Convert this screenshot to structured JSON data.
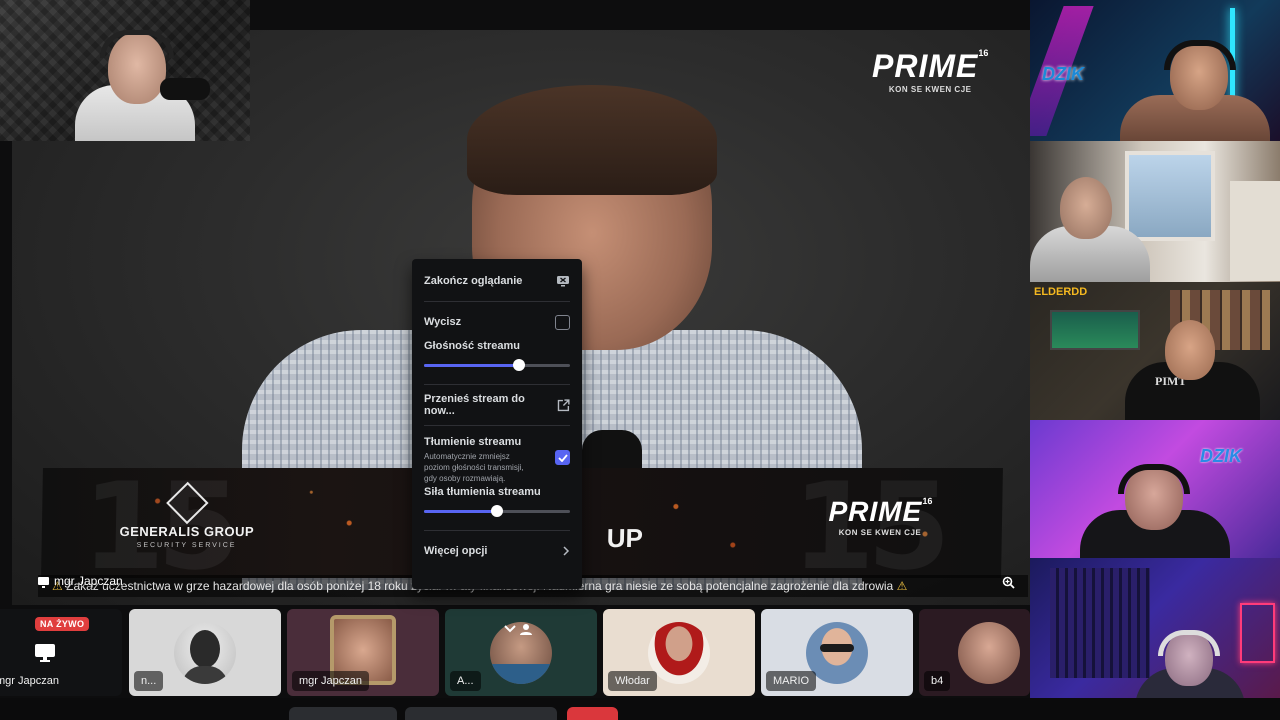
{
  "overlay": {
    "prime_word": "PRIME",
    "prime_number": "16",
    "prime_tagline": "KON SE KWEN CJE",
    "generalis_name": "GENERALIS GROUP",
    "generalis_sub": "SECURITY SERVICE",
    "banner_fragment": "UP",
    "ticker": "Zakaz uczestnictwa w grze hazardowej dla osób poniżej 18 roku życia.  …  aty finansowej. Nadmierna gra niesie ze sobą potencjalne zagrożenie dla zdrowia",
    "ticker_prefix_icon": "⚠",
    "ticker_suffix_icon": "⚠"
  },
  "stream": {
    "streamer_name": "mgr Japczan"
  },
  "context_menu": {
    "stop_watching_label": "Zakończ oglądanie",
    "mute_label": "Wycisz",
    "mute_checked": false,
    "volume_label": "Głośność streamu",
    "volume_value": 0.65,
    "popout_label": "Przenieś stream do now...",
    "attenuation_label": "Tłumienie streamu",
    "attenuation_checked": true,
    "attenuation_description": "Automatycznie zmniejsz poziom głośności transmisji, gdy osoby rozmawiają.",
    "attenuation_strength_label": "Siła tłumienia streamu",
    "attenuation_strength_value": 0.5,
    "more_options_label": "Więcej opcji",
    "accent_color": "#5865f2"
  },
  "right_column": {
    "brand_label_1": "DZIK",
    "brand_label_2": "ELDERDD",
    "brand_label_3": "DZIK",
    "shirt_text": "PIMT"
  },
  "participants": [
    {
      "name": "mgr Japczan",
      "badge": "NA ŻYWO",
      "icon": "monitor-icon",
      "bg": "#111214"
    },
    {
      "name": "n...",
      "bg": "#d8d8d8"
    },
    {
      "name": "mgr Japczan",
      "bg": "#4a2d3a"
    },
    {
      "name": "A...",
      "bg": "#1f3a36"
    },
    {
      "name": "Włodar",
      "bg": "#e9ddd0"
    },
    {
      "name": "MARIO",
      "bg": "#d9dde4"
    },
    {
      "name": "b4",
      "bg": "#2b1a22"
    }
  ]
}
